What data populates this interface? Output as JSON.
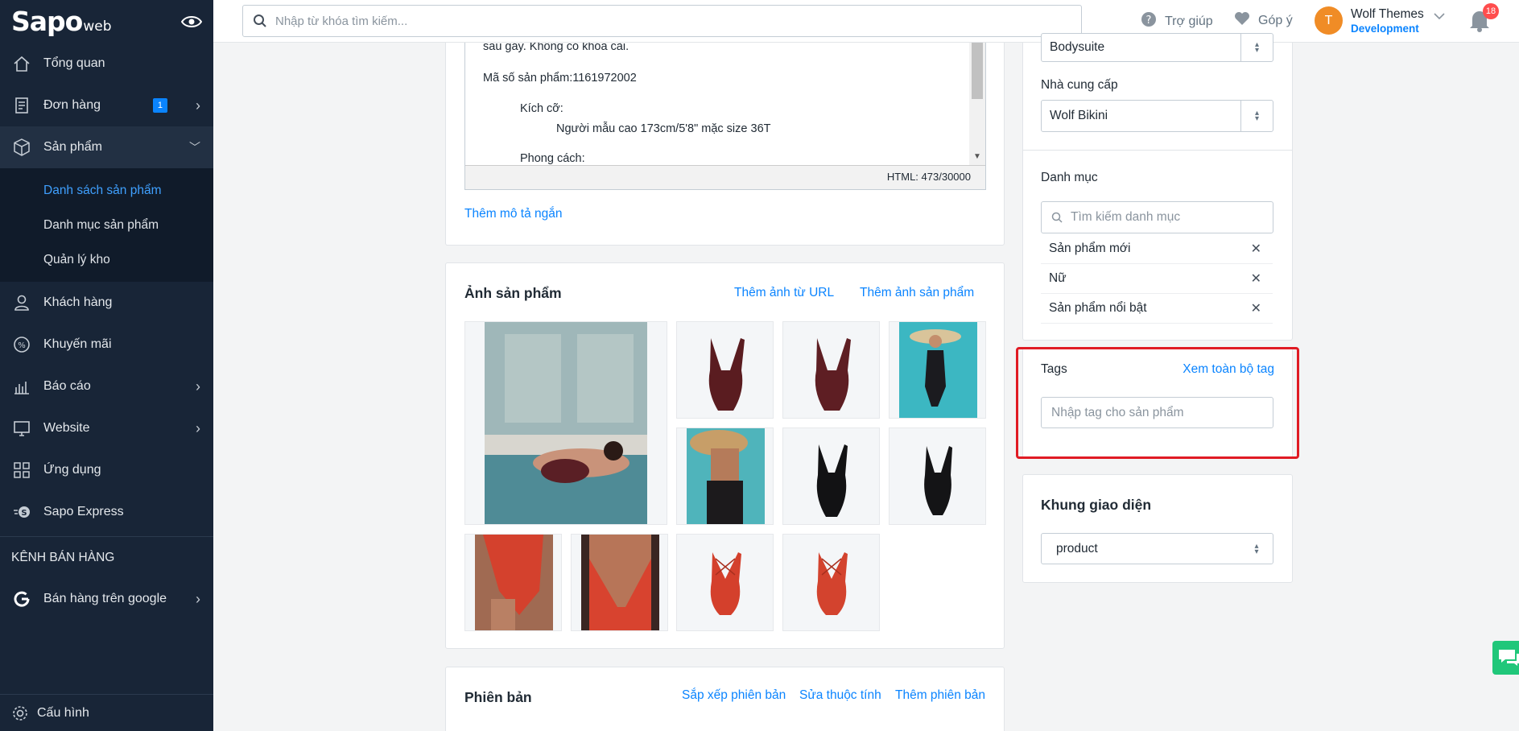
{
  "sidebar": {
    "logo_text": "Sapo",
    "logo_suffix": "web",
    "items": [
      {
        "label": "Tổng quan",
        "icon": "home-icon"
      },
      {
        "label": "Đơn hàng",
        "icon": "order-icon",
        "badge": "1"
      },
      {
        "label": "Sản phẩm",
        "icon": "box-icon"
      },
      {
        "label": "Khách hàng",
        "icon": "user-icon"
      },
      {
        "label": "Khuyến mãi",
        "icon": "discount-icon"
      },
      {
        "label": "Báo cáo",
        "icon": "report-icon"
      },
      {
        "label": "Website",
        "icon": "website-icon"
      },
      {
        "label": "Ứng dụng",
        "icon": "apps-icon"
      },
      {
        "label": "Sapo Express",
        "icon": "express-icon"
      }
    ],
    "subitems": [
      "Danh sách sản phẩm",
      "Danh mục sản phẩm",
      "Quản lý kho"
    ],
    "section_title": "KÊNH BÁN HÀNG",
    "channel_item": "Bán hàng trên google",
    "settings_label": "Cấu hình"
  },
  "topbar": {
    "search_placeholder": "Nhập từ khóa tìm kiếm...",
    "help_label": "Trợ giúp",
    "feedback_label": "Góp ý",
    "avatar_initial": "T",
    "user_name": "Wolf Themes",
    "user_role": "Development",
    "notification_count": "18"
  },
  "description": {
    "lines": [
      "sau gáy. Không có khóa cài.",
      "Mã số sản phẩm:1161972002",
      "Kích cỡ:",
      "Người mẫu cao 173cm/5'8\" mặc size 36T",
      "Phong cách:"
    ],
    "html_counter": "HTML: 473/30000",
    "add_short_desc": "Thêm mô tả ngắn"
  },
  "images": {
    "title": "Ảnh sản phẩm",
    "add_from_url": "Thêm ảnh từ URL",
    "add_image": "Thêm ảnh sản phẩm"
  },
  "variants": {
    "title": "Phiên bản",
    "sort": "Sắp xếp phiên bản",
    "edit_attrs": "Sửa thuộc tính",
    "add": "Thêm phiên bản"
  },
  "right_panel": {
    "product_type_value": "Bodysuite",
    "supplier_label": "Nhà cung cấp",
    "supplier_value": "Wolf Bikini",
    "category_label": "Danh mục",
    "category_search_placeholder": "Tìm kiếm danh mục",
    "categories": [
      "Sản phẩm mới",
      "Nữ",
      "Sản phẩm nổi bật"
    ],
    "tags_label": "Tags",
    "tags_view_all": "Xem toàn bộ tag",
    "tags_placeholder": "Nhập tag cho sản phẩm",
    "template_title": "Khung giao diện",
    "template_value": "product"
  },
  "colors": {
    "sidebar_bg": "#182537",
    "accent": "#0a84ff",
    "highlight": "#e01b24"
  }
}
